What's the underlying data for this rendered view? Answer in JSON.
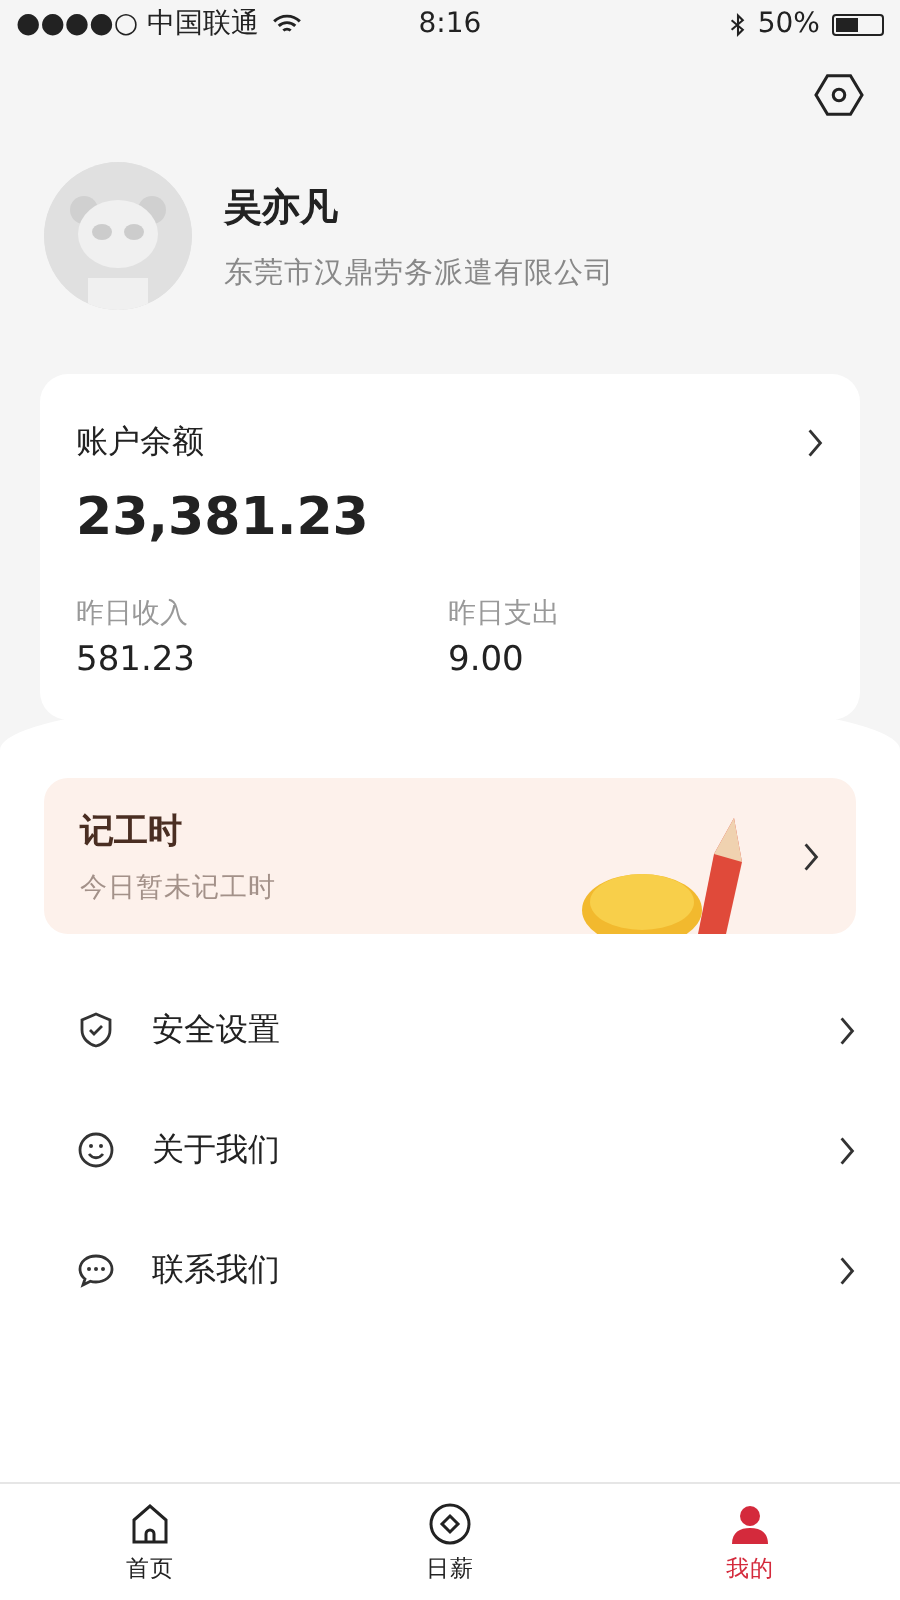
{
  "status_bar": {
    "carrier": "●●●●○ 中国联通",
    "time": "8:16",
    "battery": "50%"
  },
  "profile": {
    "name": "吴亦凡",
    "company": "东莞市汉鼎劳务派遣有限公司"
  },
  "balance": {
    "title": "账户余额",
    "amount": "23,381.23",
    "stats": [
      {
        "label": "昨日收入",
        "value": "581.23"
      },
      {
        "label": "昨日支出",
        "value": "9.00"
      }
    ]
  },
  "work_hours": {
    "title": "记工时",
    "subtitle": "今日暂未记工时"
  },
  "menu": [
    {
      "kind": "shield",
      "label": "安全设置"
    },
    {
      "kind": "smile",
      "label": "关于我们"
    },
    {
      "kind": "chat",
      "label": "联系我们"
    }
  ],
  "tab_bar": [
    {
      "kind": "home",
      "label": "首页",
      "selected": false
    },
    {
      "kind": "coin",
      "label": "日薪",
      "selected": false
    },
    {
      "kind": "person",
      "label": "我的",
      "selected": true
    }
  ]
}
